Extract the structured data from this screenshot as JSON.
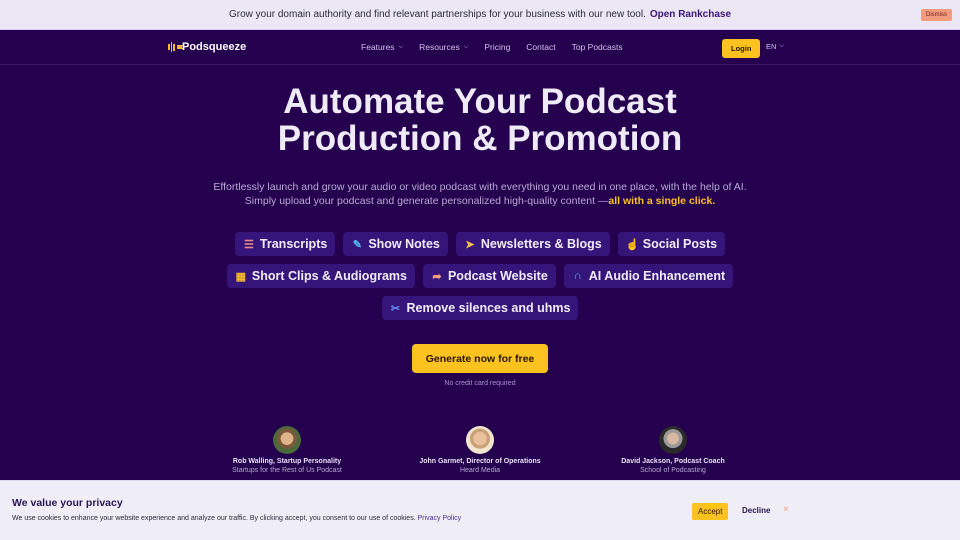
{
  "promo": {
    "text": "Grow your domain authority and find relevant partnerships for your business with our new tool.",
    "link": "Open Rankchase",
    "dismiss": "Dismiss"
  },
  "nav": {
    "brand": "Podsqueeze",
    "links": [
      {
        "label": "Features",
        "dropdown": true
      },
      {
        "label": "Resources",
        "dropdown": true
      },
      {
        "label": "Pricing",
        "dropdown": false
      },
      {
        "label": "Contact",
        "dropdown": false
      },
      {
        "label": "Top Podcasts",
        "dropdown": false
      }
    ],
    "login": "Login",
    "language": "EN"
  },
  "hero": {
    "title_line1": "Automate Your Podcast",
    "title_line2": "Production & Promotion",
    "subtitle_line1": "Effortlessly launch and grow your audio or video podcast with everything you need in one place, with the help of AI.",
    "subtitle_line2": "Simply upload your podcast and generate personalized high-quality content —",
    "subtitle_highlight": "all with a single click.",
    "cta": "Generate now for free",
    "cta_note": "No credit card required"
  },
  "features": [
    {
      "label": "Transcripts",
      "icon": "list-lines-icon",
      "glyph": "☰",
      "color": "#f08a8a"
    },
    {
      "label": "Show Notes",
      "icon": "pen-icon",
      "glyph": "✎",
      "color": "#4fb8f0"
    },
    {
      "label": "Newsletters & Blogs",
      "icon": "paper-plane-icon",
      "glyph": "➤",
      "color": "#f8c04a"
    },
    {
      "label": "Social Posts",
      "icon": "thumbs-up-icon",
      "glyph": "👍",
      "color": "#6a8cf5"
    },
    {
      "label": "Short Clips & Audiograms",
      "icon": "film-icon",
      "glyph": "▦",
      "color": "#f8b92b"
    },
    {
      "label": "Podcast Website",
      "icon": "pointer-icon",
      "glyph": "➦",
      "color": "#f49a7d"
    },
    {
      "label": "AI Audio Enhancement",
      "icon": "headphones-icon",
      "glyph": "∩",
      "color": "#4fb8f0"
    },
    {
      "label": "Remove silences and uhms",
      "icon": "scissors-icon",
      "glyph": "✂",
      "color": "#6a8cf5"
    }
  ],
  "testimonials": [
    {
      "name": "Rob Walling, Startup Personality",
      "org": "Startups for the Rest of Us Podcast"
    },
    {
      "name": "John Garmet, Director of Operations",
      "org": "Heard Media"
    },
    {
      "name": "David Jackson, Podcast Coach",
      "org": "School of Podcasting"
    }
  ],
  "cookie": {
    "title": "We value your privacy",
    "text": "We use cookies to enhance your website experience and analyze our traffic. By clicking accept, you consent to our use of cookies.",
    "policy_link": "Privacy Policy",
    "accept": "Accept",
    "decline": "Decline",
    "close": "×"
  },
  "colors": {
    "background": "#24004f",
    "accent": "#fcc220",
    "chip": "#36157a"
  }
}
